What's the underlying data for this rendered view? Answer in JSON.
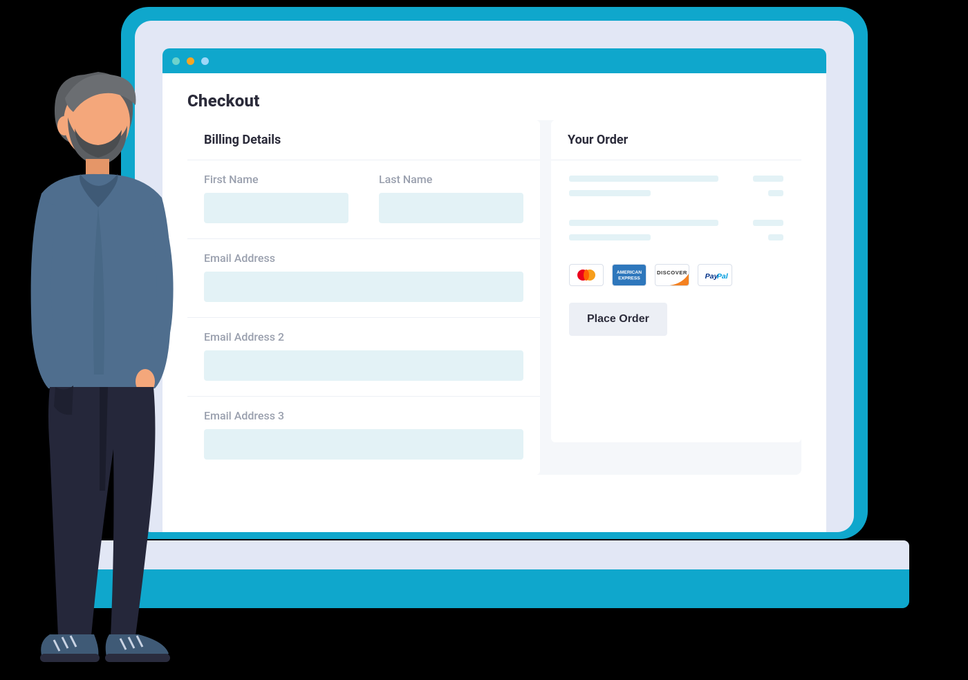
{
  "page": {
    "title": "Checkout"
  },
  "billing": {
    "title": "Billing Details",
    "fields": {
      "first_name": {
        "label": "First Name",
        "value": ""
      },
      "last_name": {
        "label": "Last Name",
        "value": ""
      },
      "email": {
        "label": "Email Address",
        "value": ""
      },
      "email2": {
        "label": "Email Address 2",
        "value": ""
      },
      "email3": {
        "label": "Email Address 3",
        "value": ""
      }
    }
  },
  "order": {
    "title": "Your Order",
    "payment_methods": [
      "mastercard",
      "american-express",
      "discover",
      "paypal"
    ],
    "place_order_label": "Place Order"
  },
  "colors": {
    "accent": "#0FA7CC",
    "input_bg": "#E3F2F6",
    "panel_bg": "#F5F7FA",
    "text": "#2B2B3A",
    "muted": "#9AA0AE"
  }
}
